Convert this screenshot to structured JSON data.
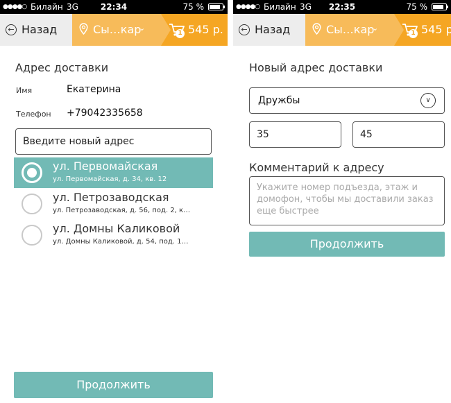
{
  "status": {
    "signal": "●●●●○",
    "carrier": "Билайн",
    "network": "3G",
    "battery": "75 %",
    "time_left": "22:34",
    "time_right": "22:35"
  },
  "nav": {
    "back_label": "Назад",
    "city_label": "Сы…кар",
    "cart_count": "1",
    "cart_sum": "545 р."
  },
  "left": {
    "title": "Адрес доставки",
    "name_label": "Имя",
    "name_value": "Екатерина",
    "phone_label": "Телефон",
    "phone_value": "+79042335658",
    "new_address_text": "Введите новый адрес",
    "addresses": [
      {
        "main": "ул. Первомайская",
        "sub": "ул. Первомайская, д. 34, кв. 12",
        "selected": true
      },
      {
        "main": "ул. Петрозаводская",
        "sub": "ул. Петрозаводская, д. 56, под. 2, к…",
        "selected": false
      },
      {
        "main": "ул. Домны Каликовой",
        "sub": "ул. Домны Каликовой, д. 54, под. 1…",
        "selected": false
      }
    ],
    "continue_label": "Продолжить"
  },
  "right": {
    "title": "Новый адрес доставки",
    "street_value": "Дружбы",
    "house_value": "35",
    "apt_value": "45",
    "comment_title": "Комментарий к адресу",
    "comment_placeholder": "Укажите номер подъезда, этаж и домофон, чтобы мы доставили заказ еще быстрее",
    "continue_label": "Продолжить"
  },
  "colors": {
    "accent_teal": "#72bab5",
    "nav_orange": "#f5a623",
    "nav_orange_light": "#f7bb5a"
  }
}
